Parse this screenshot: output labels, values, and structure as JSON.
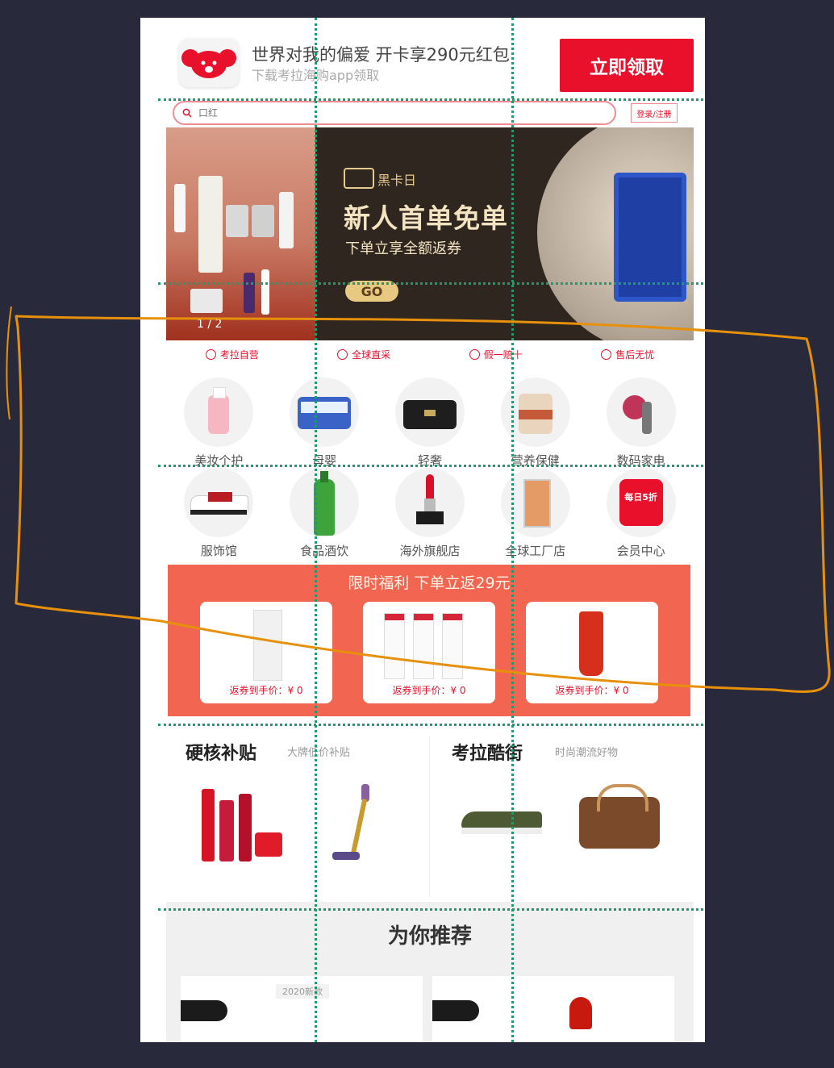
{
  "download_banner": {
    "title": "世界对我的偏爱 开卡享290元红包",
    "subtitle": "下载考拉海购app领取",
    "claim_button": "立即领取",
    "logo_icon": "koala-icon"
  },
  "search": {
    "placeholder": "口红",
    "login_label": "登录/注册"
  },
  "hero": {
    "brand": "黑卡日",
    "title": "新人首单免单",
    "subtitle": "下单立享全额返券",
    "button": "GO",
    "pager": "1 / 2"
  },
  "services": [
    {
      "label": "考拉自营"
    },
    {
      "label": "全球直采"
    },
    {
      "label": "假一赔十"
    },
    {
      "label": "售后无忧"
    }
  ],
  "categories_row1": [
    {
      "label": "美妆个护"
    },
    {
      "label": "母婴"
    },
    {
      "label": "轻奢"
    },
    {
      "label": "营养保健"
    },
    {
      "label": "数码家电"
    }
  ],
  "categories_row2": [
    {
      "label": "服饰馆"
    },
    {
      "label": "食品酒饮"
    },
    {
      "label": "海外旗舰店"
    },
    {
      "label": "全球工厂店"
    },
    {
      "label": "会员中心"
    }
  ],
  "member_badge": "每日5折",
  "flash_deal": {
    "title": "限时福利 下单立返29元",
    "cards": [
      {
        "price": "返券到手价：¥ 0"
      },
      {
        "price": "返券到手价：¥ 0"
      },
      {
        "price": "返券到手价：¥ 0"
      }
    ]
  },
  "subsidy": {
    "title": "硬核补贴",
    "subtitle": "大牌低价补贴"
  },
  "street": {
    "title": "考拉酷街",
    "subtitle": "时尚潮流好物"
  },
  "recommend": {
    "title": "为你推荐",
    "card_tag": "2020新款"
  },
  "colors": {
    "brand_red": "#e8102a",
    "flash_bg": "#f26651",
    "guide_green": "#1e9a6d",
    "annotation_orange": "#e6900c",
    "frame_bg": "#282a3c"
  }
}
